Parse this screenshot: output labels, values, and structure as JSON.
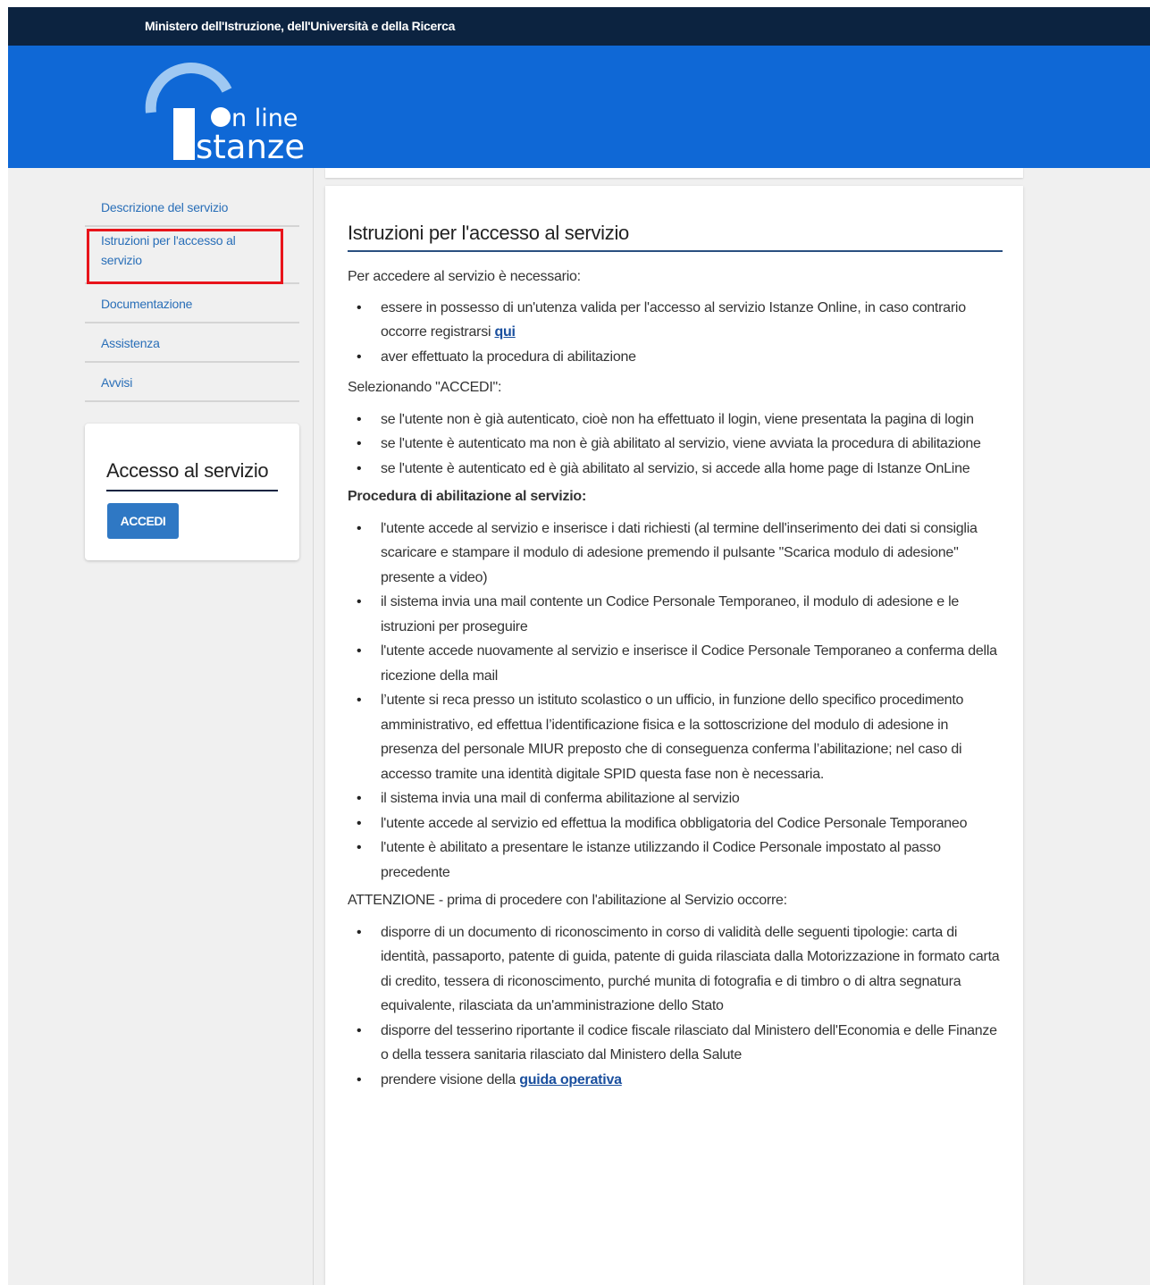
{
  "topbar": {
    "title": "Ministero dell'Istruzione, dell'Università e della Ricerca"
  },
  "logo": {
    "line1": "n line",
    "line2": "stanze"
  },
  "sidebar": {
    "items": [
      {
        "label": "Descrizione del servizio"
      },
      {
        "label": "Istruzioni per l'accesso al servizio",
        "highlighted": true
      },
      {
        "label": "Documentazione"
      },
      {
        "label": "Assistenza"
      },
      {
        "label": "Avvisi"
      }
    ]
  },
  "access_box": {
    "title": "Accesso al servizio",
    "button_label": "ACCEDI"
  },
  "main": {
    "title": "Istruzioni per l'accesso al servizio",
    "intro": "Per accedere al servizio è necessario:",
    "requirements": [
      {
        "text": "essere in possesso di un'utenza valida per l'accesso al servizio Istanze Online, in caso contrario occorre registrarsi ",
        "link": "qui"
      },
      {
        "text": "aver effettuato la procedura di abilitazione"
      }
    ],
    "select_intro": "Selezionando \"ACCEDI\":",
    "select_items": [
      "se l'utente non è già autenticato, cioè non ha effettuato il login, viene presentata la pagina di login",
      "se l'utente è autenticato ma non è già abilitato al servizio, viene avviata la procedura di abilitazione",
      "se l'utente è autenticato ed è già abilitato al servizio, si accede alla home page di Istanze OnLine"
    ],
    "procedure_title": "Procedura di abilitazione al servizio:",
    "procedure_items": [
      "l'utente accede al servizio e inserisce i dati richiesti (al termine dell'inserimento dei dati si consiglia scaricare e stampare il modulo di adesione premendo il pulsante \"Scarica modulo di adesione\" presente a video)",
      "il sistema invia una mail contente un Codice Personale Temporaneo, il modulo di adesione e le istruzioni per proseguire",
      "l'utente accede nuovamente al servizio e inserisce il Codice Personale Temporaneo a conferma della ricezione della mail",
      "l’utente si reca presso un istituto scolastico o un ufficio, in funzione dello specifico procedimento amministrativo, ed effettua l’identificazione fisica e la sottoscrizione del modulo di adesione in presenza del personale MIUR preposto che di conseguenza conferma l’abilitazione; nel caso di accesso tramite una identità digitale SPID questa fase non è necessaria.",
      "il sistema invia una mail di conferma abilitazione al servizio",
      "l'utente accede al servizio ed effettua la modifica obbligatoria del Codice Personale Temporaneo",
      "l'utente è abilitato a presentare le istanze utilizzando il Codice Personale impostato al passo precedente"
    ],
    "attention_intro": "ATTENZIONE - prima di procedere con l'abilitazione al Servizio occorre:",
    "attention_items": [
      {
        "text": "disporre di un documento di riconoscimento in corso di validità delle seguenti tipologie: carta di identità, passaporto, patente di guida, patente di guida rilasciata dalla Motorizzazione in formato carta di credito, tessera di riconoscimento, purché munita di fotografia e di timbro o di altra segnatura equivalente, rilasciata da un'amministrazione dello Stato"
      },
      {
        "text": "disporre del tesserino riportante il codice fiscale rilasciato dal Ministero dell'Economia e delle Finanze o della tessera sanitaria rilasciato dal Ministero della Salute"
      },
      {
        "text": "prendere visione della ",
        "link": "guida operativa"
      }
    ]
  },
  "colors": {
    "topbar": "#0c2340",
    "header": "#0f68d6",
    "link": "#2a6fb8",
    "button": "#2f78c4",
    "highlight_box": "#e8141b"
  }
}
